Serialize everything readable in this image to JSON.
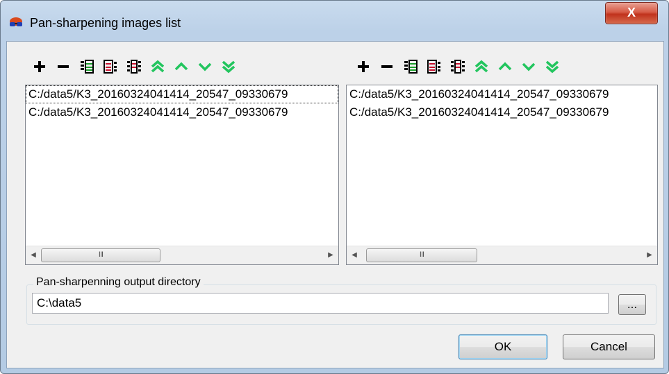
{
  "window": {
    "title": "Pan-sharpening images list",
    "close_label": "X"
  },
  "toolbar_icons": [
    "add-icon",
    "remove-icon",
    "list-icon",
    "list-alt-icon",
    "list-columns-icon",
    "move-top-icon",
    "move-up-icon",
    "move-down-icon",
    "move-bottom-icon"
  ],
  "left_list": {
    "items": [
      "C:/data5/K3_20160324041414_20547_09330679",
      "C:/data5/K3_20160324041414_20547_09330679"
    ]
  },
  "right_list": {
    "items": [
      "C:/data5/K3_20160324041414_20547_09330679",
      "C:/data5/K3_20160324041414_20547_09330679"
    ]
  },
  "scroll_thumb_label": "III",
  "output": {
    "group_label": "Pan-sharpenning output directory",
    "value": "C:\\data5",
    "browse_label": "..."
  },
  "buttons": {
    "ok": "OK",
    "cancel": "Cancel"
  },
  "colors": {
    "accent_green": "#22c55e",
    "icon_red": "#c8102e",
    "close_red": "#c0321d"
  }
}
